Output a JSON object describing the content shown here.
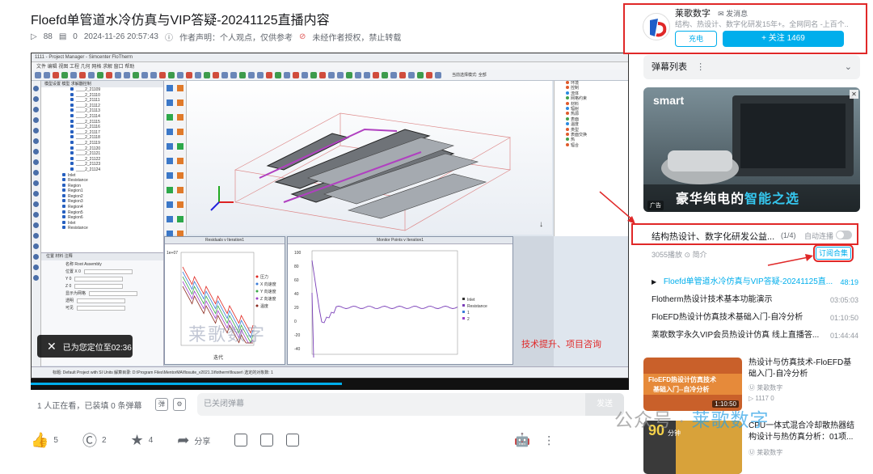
{
  "video": {
    "title": "Floefd单管道水冷仿真与VIP答疑-20241125直播内容",
    "plays": "88",
    "danmaku_count": "0",
    "datetime": "2024-11-26 20:57:43",
    "author_note": "作者声明：个人观点，仅供参考",
    "no_repost": "未经作者授权，禁止转载"
  },
  "player": {
    "app_title": "1111 - Project Manager - Simcenter FloTherm",
    "menu": "文件  编辑  视图  工程  几何  网格  求解  窗口  帮助",
    "select_mode": "当前选择模式: 全部",
    "tree_tabs": "模型设置  模型  求解器控制",
    "tree_items": [
      "____2_21109",
      "____2_21110",
      "____2_21111",
      "____2_21112",
      "____2_21113",
      "____2_21114",
      "____2_21115",
      "____2_21116",
      "____2_21117",
      "____2_21118",
      "____2_21119",
      "____2_21120",
      "____2_21121",
      "____2_21122",
      "____2_21123",
      "____2_21124"
    ],
    "tree_roots": [
      "Inlet",
      "Resistance",
      "Region",
      "Region1",
      "Region2",
      "Region3",
      "Region4",
      "Region5",
      "Region6",
      "Inlet",
      "Resistance"
    ],
    "props_tabs": "位置  材料  注释",
    "props_name": "名称 Root Assembly",
    "props_rows": [
      "位置 X 0",
      "Y 0",
      "Z 0",
      "显示为网格",
      "透明",
      "可见"
    ],
    "right_items": [
      "环境",
      "控制",
      "流体",
      "网格约束",
      "材料",
      "辐射",
      "热源",
      "表面",
      "温度",
      "类型",
      "表面交换",
      "热",
      "辐合"
    ],
    "plot1_title": "Residuals v Iteration1",
    "plot1_legend": [
      "压力",
      "X 向速度",
      "Y 向速度",
      "Z 向速度",
      "温度"
    ],
    "plot1_xlabel": "迭代",
    "plot1_ymax": "1e+07",
    "plot2_title": "Monitor Points v Iteration1",
    "plot2_legend": [
      "Inlet",
      "Resistance",
      "1",
      "2"
    ],
    "plot2_ticks": [
      "100",
      "80",
      "60",
      "40",
      "20",
      "0",
      "-20",
      "-40"
    ],
    "status": "标题: Default Project with SI Units  解算目录: D:\\Program Files\\MentorMA\\flosuite_v2021.1\\flotherm\\flouser\\  选定的对象数: 1",
    "toast": "已为您定位至02:36",
    "watermark": "莱歌数字",
    "tech_text": "技术提升、项目咨询",
    "progress_pct": 52
  },
  "danmaku_bar": {
    "watching": "1 人正在看，已装填 0 条弹幕",
    "placeholder": "已关闭弹幕",
    "send": "发送"
  },
  "actions": {
    "like": "5",
    "coin": "2",
    "fav": "4",
    "share": "分享"
  },
  "uploader": {
    "name": "莱歌数字",
    "message": "发消息",
    "desc": "结构、热设计、数字化研发15年+。全网同名 -上百个...",
    "charge": "充电",
    "follow": "+ 关注 1469"
  },
  "danmaku_list": {
    "label": "弹幕列表",
    "icon": "⋮"
  },
  "ad": {
    "brand": "smart",
    "slogan": "豪华纯电的",
    "slogan_hl": "智能之选",
    "tag": "广告"
  },
  "collection": {
    "title": "结构热设计、数字化研发公益...",
    "count": "(1/4)",
    "autoplay": "自动连播",
    "stats": "3055播放 ⊙ 简介",
    "subscribe": "订阅合集",
    "items": [
      {
        "title": "Floefd单管道水冷仿真与VIP答疑-20241125直...",
        "dur": "48:19",
        "active": true
      },
      {
        "title": "Flotherm热设计技术基本功能演示",
        "dur": "03:05:03"
      },
      {
        "title": "FloEFD热设计仿真技术基础入门-自冷分析",
        "dur": "01:10:50"
      },
      {
        "title": "莱歌数字永久VIP会员热设计仿真 线上直播答...",
        "dur": "01:44:44"
      }
    ]
  },
  "recommend": [
    {
      "title": "热设计与仿真技术-FloEFD基础入门-自冷分析",
      "author": "莱歌数字",
      "stats": "1117  0",
      "dur": "1:10:50",
      "thumb1": "FloEFD热设计仿真技术",
      "thumb2": "基础入门--自冷分析"
    },
    {
      "title": "CPU一体式混合冷却散热器结构设计与热仿真分析：01项...",
      "author": "莱歌数字",
      "thumb1": "90",
      "thumb2": "分钟"
    }
  ],
  "wechat_watermark": {
    "prefix": "公众号 · ",
    "name": "莱歌数字"
  },
  "colors": {
    "accent": "#00aeec",
    "highlight": "#e02828"
  }
}
